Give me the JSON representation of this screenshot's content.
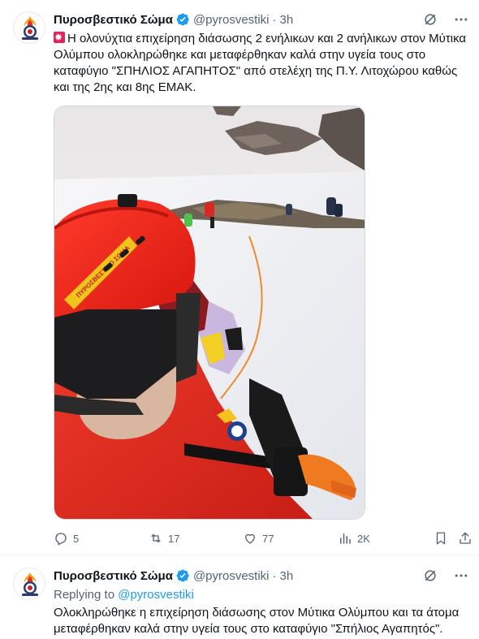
{
  "colors": {
    "link": "#1d9bf0",
    "secondary_text": "#536471",
    "verified": "#1d9bf0",
    "brand_red": "#e0245e"
  },
  "tweets": [
    {
      "author": {
        "name": "Πυροσβεστικό Σώμα",
        "handle": "@pyrosvestiki",
        "verified": true,
        "avatar": "fire-service-logo"
      },
      "time": "3h",
      "text": "Η ολονύχτια επιχείρηση διάσωσης 2 ενήλικων και 2 ανήλικων στον Μύτικα Ολύμπου ολοκληρώθηκε και μεταφέρθηκαν καλά στην υγεία τους στο καταφύγιο \"ΣΠΗΛΙΟΣ ΑΓΑΠΗΤΟΣ\" από στελέχη της Π.Υ. Λιτοχώρου καθώς και της 2ης και 8ης ΕΜΑΚ.",
      "media": {
        "type": "photo",
        "helmet_text": "ΠΥΡΟΣΒΕΣΤΙΚΟ ΣΩΜΑ"
      },
      "actions": {
        "replies": "5",
        "retweets": "17",
        "likes": "77",
        "views": "2K"
      }
    },
    {
      "author": {
        "name": "Πυροσβεστικό Σώμα",
        "handle": "@pyrosvestiki",
        "verified": true,
        "avatar": "fire-service-logo"
      },
      "time": "3h",
      "replying_label": "Replying to",
      "replying_to": "@pyrosvestiki",
      "text": "Ολοκληρώθηκε η επιχείρηση διάσωσης στον Μύτικα Ολύμπου και τα άτομα μεταφέρθηκαν καλά στην υγεία τους στο καταφύγιο \"Σπήλιος Αγαπητός\"."
    }
  ],
  "separators": {
    "dot": "·"
  }
}
